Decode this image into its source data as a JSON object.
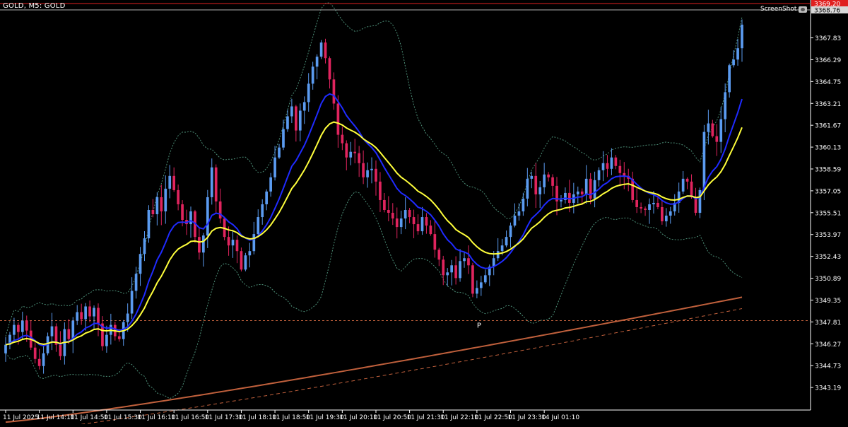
{
  "header": {
    "symbol_line": "GOLD, M5:  GOLD",
    "screenshot_label": "ScreenShot",
    "screenshot_icon": "camera-icon"
  },
  "colors": {
    "background": "#000000",
    "grid_axis": "#ffffff",
    "bull_candle": "#5b9bf0",
    "bear_candle": "#e0245e",
    "ma_fast": "#1f2bff",
    "ma_slow": "#ffff3b",
    "bollinger": "#4d8f78",
    "ma_long": "#c0603c",
    "pivot_line": "#c0603c",
    "ask_line": "#e02020",
    "bid_line": "#b0b0b0"
  },
  "chart_data": {
    "type": "candlestick",
    "title": "GOLD, M5:  GOLD",
    "ylim": [
      3341.6,
      3369.8
    ],
    "y_ticks": [
      "3367.83",
      "3366.29",
      "3364.75",
      "3363.21",
      "3361.67",
      "3360.13",
      "3358.59",
      "3357.05",
      "3355.51",
      "3353.97",
      "3352.43",
      "3350.89",
      "3349.35",
      "3347.81",
      "3346.27",
      "3344.73",
      "3343.19"
    ],
    "y_tick_values": [
      3367.83,
      3366.29,
      3364.75,
      3363.21,
      3361.67,
      3360.13,
      3358.59,
      3357.05,
      3355.51,
      3353.97,
      3352.43,
      3350.89,
      3349.35,
      3347.81,
      3346.27,
      3344.73,
      3343.19
    ],
    "x_ticks": [
      "11 Jul 2025",
      "11 Jul 14:10",
      "11 Jul 14:50",
      "11 Jul 15:30",
      "11 Jul 16:10",
      "11 Jul 16:50",
      "11 Jul 17:30",
      "11 Jul 18:10",
      "11 Jul 18:50",
      "11 Jul 19:30",
      "11 Jul 20:10",
      "11 Jul 20:50",
      "11 Jul 21:30",
      "11 Jul 22:10",
      "11 Jul 22:50",
      "11 Jul 23:30",
      "14 Jul 01:10"
    ],
    "x_tick_bar_index": [
      0,
      8,
      16,
      24,
      32,
      40,
      48,
      56,
      64,
      72,
      80,
      88,
      96,
      104,
      112,
      120,
      128
    ],
    "price_labels": {
      "ask": {
        "value": 3369.2,
        "text": "3369.20"
      },
      "bid": {
        "value": 3368.76,
        "text": "3368.76"
      }
    },
    "pivot": {
      "label": "P",
      "value": 3347.9,
      "bar_index": 112
    },
    "candle_closes": [
      3346.2,
      3346.9,
      3347.6,
      3347.1,
      3347.9,
      3347.2,
      3346.0,
      3345.2,
      3344.7,
      3345.6,
      3346.8,
      3347.5,
      3346.2,
      3345.4,
      3347.3,
      3346.6,
      3347.9,
      3348.5,
      3348.0,
      3348.9,
      3348.2,
      3348.8,
      3347.7,
      3346.1,
      3346.9,
      3347.6,
      3346.8,
      3346.6,
      3347.8,
      3348.4,
      3350.0,
      3351.2,
      3352.6,
      3353.7,
      3355.7,
      3355.4,
      3356.6,
      3355.6,
      3357.2,
      3358.1,
      3357.1,
      3356.1,
      3355.0,
      3354.7,
      3355.6,
      3353.8,
      3352.7,
      3353.9,
      3356.6,
      3358.7,
      3356.3,
      3355.1,
      3353.8,
      3353.2,
      3353.6,
      3352.8,
      3351.5,
      3352.5,
      3352.8,
      3354.0,
      3355.2,
      3356.1,
      3357.0,
      3358.0,
      3359.4,
      3360.1,
      3361.4,
      3362.3,
      3363.0,
      3361.3,
      3362.7,
      3363.3,
      3364.6,
      3365.8,
      3366.5,
      3367.5,
      3366.4,
      3364.9,
      3363.2,
      3361.0,
      3360.4,
      3359.4,
      3359.8,
      3359.7,
      3359.0,
      3358.0,
      3358.5,
      3358.6,
      3357.7,
      3356.4,
      3355.7,
      3355.5,
      3355.1,
      3354.5,
      3355.1,
      3355.7,
      3355.2,
      3354.7,
      3354.2,
      3355.2,
      3354.6,
      3354.0,
      3352.9,
      3352.2,
      3351.1,
      3351.3,
      3351.8,
      3350.9,
      3352.1,
      3352.3,
      3351.8,
      3349.8,
      3350.2,
      3350.6,
      3351.1,
      3351.7,
      3352.3,
      3352.8,
      3353.2,
      3353.8,
      3354.6,
      3355.3,
      3355.6,
      3356.5,
      3357.9,
      3358.1,
      3356.8,
      3357.3,
      3358.2,
      3358.0,
      3357.4,
      3356.3,
      3356.4,
      3356.9,
      3356.2,
      3356.8,
      3357.0,
      3356.8,
      3357.9,
      3356.5,
      3357.8,
      3358.5,
      3359.0,
      3358.6,
      3359.4,
      3358.8,
      3358.3,
      3358.1,
      3357.9,
      3356.4,
      3355.9,
      3355.8,
      3355.7,
      3356.1,
      3356.2,
      3355.9,
      3354.9,
      3355.3,
      3355.6,
      3356.2,
      3357.0,
      3357.9,
      3357.7,
      3356.6,
      3355.5,
      3357.1,
      3361.2,
      3361.8,
      3360.9,
      3360.5,
      3362.1,
      3364.0,
      3365.9,
      3366.3,
      3367.1,
      3368.76
    ],
    "series": [
      {
        "name": "",
        "kind": "fast_ma"
      },
      {
        "name": "",
        "kind": "slow_ma"
      },
      {
        "name": "",
        "kind": "bollinger_bands"
      },
      {
        "name": "",
        "kind": "long_ma"
      }
    ]
  }
}
